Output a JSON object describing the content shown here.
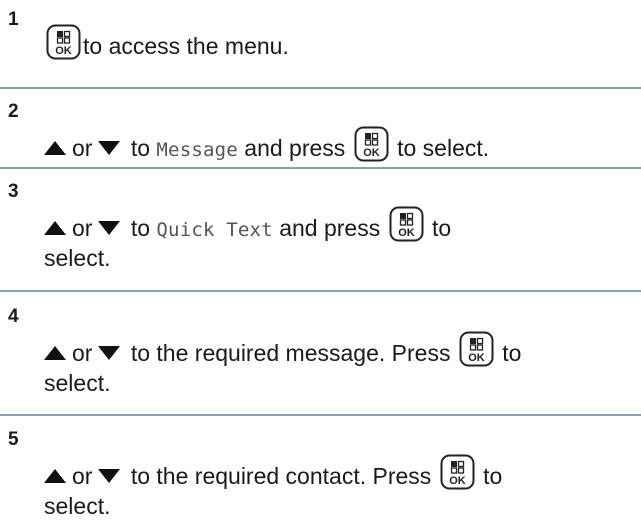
{
  "steps": [
    {
      "number": "1",
      "text": "to access the menu."
    },
    {
      "number": "2",
      "or": "or",
      "to": "to",
      "item": "Message",
      "press": "and press",
      "after": "to select."
    },
    {
      "number": "3",
      "or": "or",
      "to": "to",
      "item": "Quick Text",
      "press": "and press",
      "after": "to",
      "cont": "select."
    },
    {
      "number": "4",
      "or": "or",
      "text": "to the required message. Press",
      "after": "to",
      "cont": "select."
    },
    {
      "number": "5",
      "or": "or",
      "text": "to the required contact. Press",
      "after": "to",
      "cont": "select."
    }
  ],
  "icons": {
    "ok_button": "menu-ok-button-icon",
    "up": "up-arrow-icon",
    "down": "down-arrow-icon"
  },
  "colors": {
    "divider": "#8ba0b3",
    "text": "#1a1a1a",
    "mono_text": "#555555"
  }
}
